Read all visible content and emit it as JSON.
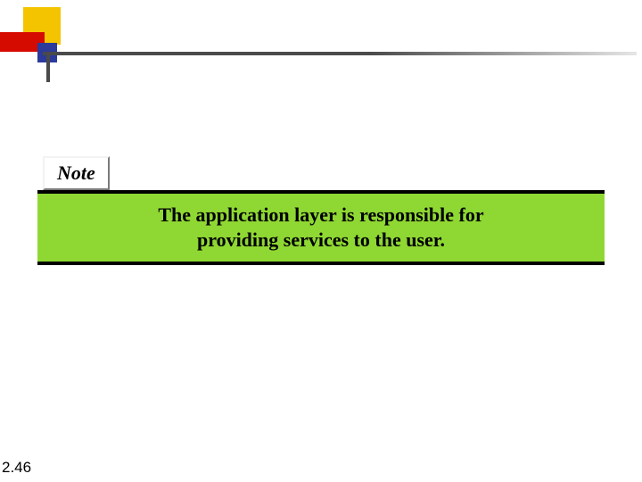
{
  "note_label": "Note",
  "message_line1": "The application layer is responsible for",
  "message_line2": "providing services to the user.",
  "page_number": "2.46",
  "colors": {
    "highlight_green": "#8fd833",
    "accent_yellow": "#f4c400",
    "accent_red": "#d60b00",
    "accent_blue": "#2b3a9b",
    "rule_dark": "#4a4a4a"
  }
}
